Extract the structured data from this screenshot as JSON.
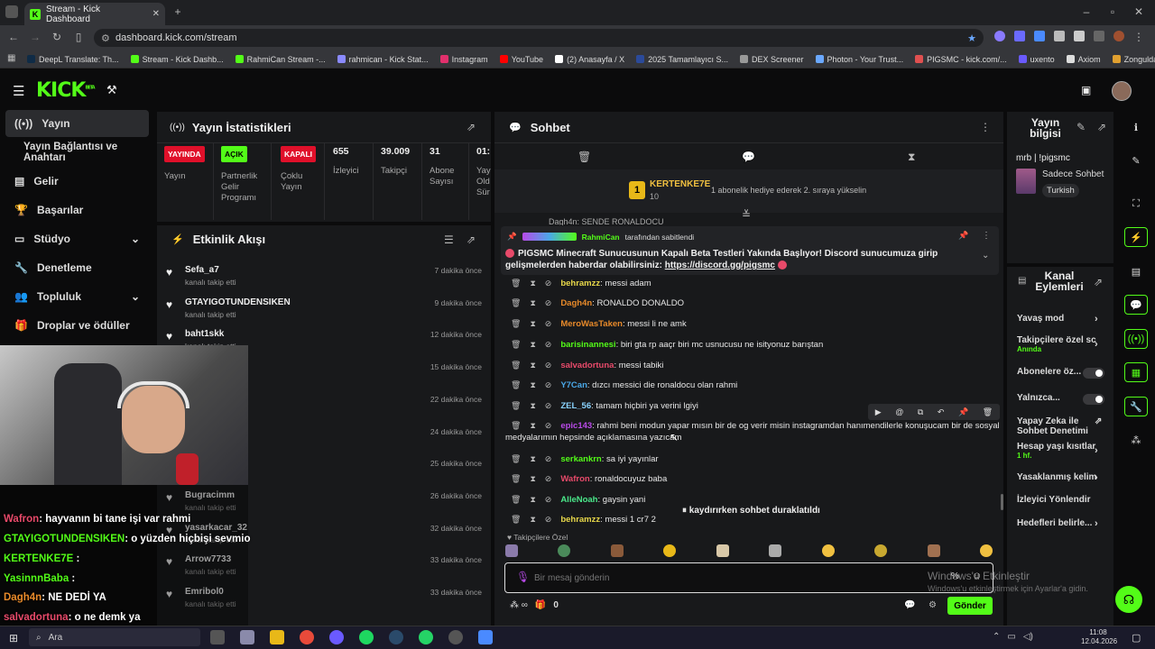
{
  "browser": {
    "tab_title": "Stream - Kick Dashboard",
    "url": "dashboard.kick.com/stream"
  },
  "bookmarks": [
    {
      "label": "DeepL Translate: Th...",
      "color": "#0f2b46"
    },
    {
      "label": "Stream - Kick Dashb...",
      "color": "#53fc18"
    },
    {
      "label": "RahmiCan Stream -...",
      "color": "#53fc18"
    },
    {
      "label": "rahmican - Kick Stat...",
      "color": "#8a8aff"
    },
    {
      "label": "Instagram",
      "color": "#e1306c"
    },
    {
      "label": "YouTube",
      "color": "#ff0000"
    },
    {
      "label": "(2) Anasayfa / X",
      "color": "#ffffff"
    },
    {
      "label": "2025 Tamamlayıcı S...",
      "color": "#2b4a9a"
    },
    {
      "label": "DEX Screener",
      "color": "#999999"
    },
    {
      "label": "Photon - Your Trust...",
      "color": "#6aa8ff"
    },
    {
      "label": "PIGSMC - kick.com/...",
      "color": "#e05050"
    },
    {
      "label": "uxento",
      "color": "#6a5aff"
    },
    {
      "label": "Axiom",
      "color": "#dddddd"
    },
    {
      "label": "Zonguldak İngilizce...",
      "color": "#e0a030"
    }
  ],
  "sidebar": {
    "items": [
      {
        "label": "Yayın",
        "icon": "broadcast-icon"
      },
      {
        "label": "Yayın Bağlantısı ve Anahtarı",
        "icon": ""
      },
      {
        "label": "Gelir",
        "icon": "revenue-icon"
      },
      {
        "label": "Başarılar",
        "icon": "trophy-icon"
      },
      {
        "label": "Stüdyo",
        "icon": "studio-icon"
      },
      {
        "label": "Denetleme",
        "icon": "wrench-icon"
      },
      {
        "label": "Topluluk",
        "icon": "community-icon"
      },
      {
        "label": "Droplar ve ödüller",
        "icon": "gift-icon"
      }
    ]
  },
  "stats": {
    "title": "Yayın İstatistikleri",
    "items": [
      {
        "badge": "YAYINDA",
        "label": "Yayın",
        "color": "#e0102a"
      },
      {
        "badge": "AÇIK",
        "label": "Partnerlik Gelir Programı",
        "color": "#53fc18"
      },
      {
        "badge": "KAPALI",
        "label": "Çoklu Yayın",
        "color": "#e0102a"
      },
      {
        "value": "655",
        "label": "İzleyici"
      },
      {
        "value": "39.009",
        "label": "Takipçi"
      },
      {
        "value": "31",
        "label": "Abone Sayısı"
      },
      {
        "value": "01:",
        "label": "Yay Old Sür"
      }
    ]
  },
  "activity": {
    "title": "Etkinlik Akışı",
    "items": [
      {
        "name": "Sefa_a7",
        "sub": "kanalı takip etti",
        "time": "7 dakika önce"
      },
      {
        "name": "GTAYIGOTUNDENSIKEN",
        "sub": "kanalı takip etti",
        "time": "9 dakika önce"
      },
      {
        "name": "baht1skk",
        "sub": "kanalı takip etti",
        "time": "12 dakika önce"
      },
      {
        "name": "",
        "sub": "",
        "time": "15 dakika önce"
      },
      {
        "name": "",
        "sub": "",
        "time": "22 dakika önce"
      },
      {
        "name": "",
        "sub": "",
        "time": "24 dakika önce"
      },
      {
        "name": "",
        "sub": "",
        "time": "25 dakika önce"
      },
      {
        "name": "Bugracimm",
        "sub": "kanalı takip etti",
        "time": "26 dakika önce"
      },
      {
        "name": "yasarkacar_32",
        "sub": "kanalı takip etti",
        "time": "32 dakika önce"
      },
      {
        "name": "Arrow7733",
        "sub": "kanalı takip etti",
        "time": "33 dakika önce"
      },
      {
        "name": "Emribol0",
        "sub": "kanalı takip etti",
        "time": "33 dakika önce"
      }
    ]
  },
  "chat": {
    "title": "Sohbet",
    "top_gifter": {
      "name": "KERTENKE7E",
      "count": "10",
      "note": "1 abonelik hediye ederek 2. sıraya yükselin"
    },
    "pinned": {
      "by": "RahmiCan",
      "by_suffix": "tarafından sabitlendi",
      "text": "PIGSMC Minecraft Sunucusunun Kapalı Beta Testleri Yakında Başlıyor! Discord sunucumuza girip gelişmelerden haberdar olabilirsiniz:",
      "link": "https://discord.gg/pigsmc"
    },
    "top_partial": "Dagh4n: SENDE RONALDOCU",
    "messages": [
      {
        "user": "behramzz",
        "color": "#e8d84a",
        "text": "messi adam"
      },
      {
        "user": "Dagh4n",
        "color": "#e88a2a",
        "text": "RONALDO DONALDO"
      },
      {
        "user": "MeroWasTaken",
        "color": "#e88a2a",
        "text": "messi li ne amk"
      },
      {
        "user": "barisinannesi",
        "color": "#53fc18",
        "text": "biri gta rp aaçr biri mc usnucusu ne isityonuz barıştan"
      },
      {
        "user": "salvadortuna",
        "color": "#e84a6a",
        "text": "messi tabiki"
      },
      {
        "user": "Y7Can",
        "color": "#4aa8e8",
        "text": "dızcı messici die ronaldocu olan rahmi"
      },
      {
        "user": "ZEL_56",
        "color": "#8ad4ff",
        "text": "tamam hiçbiri ya verini lgiyi"
      },
      {
        "user": "epic143",
        "color": "#b84ae8",
        "text": "rahmi beni modun yapar mısın bir de og verir misin instagramdan hanımendilerle konuşucam bir de sosyal",
        "text2": "medyalarımın hepsinde açıklamasına yazıcam"
      },
      {
        "user": "serkankrn",
        "color": "#53fc18",
        "text": "sa iyi yayınlar"
      },
      {
        "user": "Wafron",
        "color": "#e84a6a",
        "text": "ronaldocuyuz baba"
      },
      {
        "user": "AlleNoah",
        "color": "#4ae88a",
        "text": "gaysin yani"
      },
      {
        "user": "behramzz",
        "color": "#e8d84a",
        "text": "messi 1 cr7 2"
      }
    ],
    "paused": "kaydırırken sohbet duraklatıldı",
    "followers_only": "Takipçilere Özel",
    "input_placeholder": "Bir mesaj gönderin",
    "send": "Gönder",
    "count": "0"
  },
  "stream_info": {
    "title": "Yayın bilgisi",
    "name": "mrb | !pigsmc",
    "category": "Sadece Sohbet",
    "language": "Turkish"
  },
  "channel_actions": {
    "title": "Kanal Eylemleri",
    "items": [
      {
        "label": "Yavaş mod",
        "type": "arrow"
      },
      {
        "label": "Takipçilere özel sc",
        "sub": "Anında",
        "type": "arrow"
      },
      {
        "label": "Abonelere öz...",
        "type": "toggle"
      },
      {
        "label": "Yalnızca...",
        "type": "toggle"
      },
      {
        "label": "Yapay Zeka ile Sohbet Denetimi",
        "type": "external"
      },
      {
        "label": "Hesap yaşı kısıtlar",
        "sub": "1 hf.",
        "type": "arrow"
      },
      {
        "label": "Yasaklanmış kelim",
        "type": "arrow"
      },
      {
        "label": "İzleyici Yönlendir",
        "type": "none"
      },
      {
        "label": "Hedefleri belirle...",
        "type": "arrow"
      }
    ]
  },
  "overlay_chat": [
    {
      "user": "Wafron",
      "color": "#e84a6a",
      "text": ": hayvanın bi tane işi var rahmi"
    },
    {
      "user": "GTAYIGOTUNDENSIKEN",
      "color": "#53fc18",
      "text": ": o yüzden hiçbişi sevmio"
    },
    {
      "user": "KERTENKE7E",
      "color": "#53fc18",
      "text": " :"
    },
    {
      "user": "YasinnnBaba",
      "color": "#53fc18",
      "text": " :"
    },
    {
      "user": "Dagh4n",
      "color": "#e88a2a",
      "text": ": NE DEDİ YA"
    },
    {
      "user": "salvadortuna",
      "color": "#e84a6a",
      "text": ": o ne demk ya"
    }
  ],
  "watermark": {
    "line1": "Windows'u Etkinleştir",
    "line2": "Windows'u etkinleştirmek için Ayarlar'a gidin."
  },
  "taskbar": {
    "search": "Ara",
    "time": "11:08",
    "date": "12.04.2026"
  }
}
